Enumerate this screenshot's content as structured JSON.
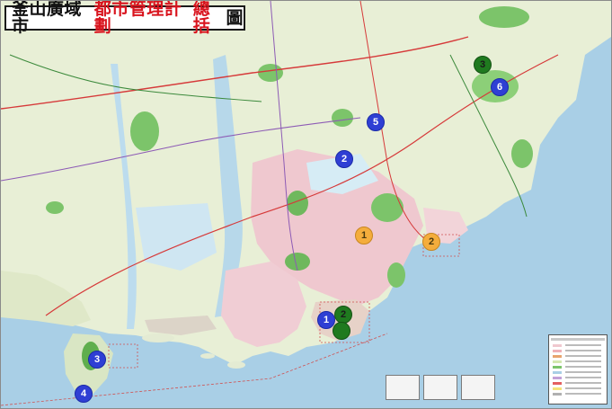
{
  "title": {
    "part1": "釜山廣域市",
    "part2": "都市管理計劃",
    "part3": "總括",
    "part4": "圖"
  },
  "markers": [
    {
      "label": "1",
      "color": "blue"
    },
    {
      "label": "2",
      "color": "blue"
    },
    {
      "label": "3",
      "color": "blue"
    },
    {
      "label": "4",
      "color": "blue"
    },
    {
      "label": "5",
      "color": "blue"
    },
    {
      "label": "6",
      "color": "blue"
    },
    {
      "label": "2",
      "color": "green"
    },
    {
      "label": "3",
      "color": "green"
    },
    {
      "label": "",
      "color": "green"
    },
    {
      "label": "1",
      "color": "orange"
    },
    {
      "label": "2",
      "color": "orange"
    }
  ],
  "colors": {
    "sea": "#a9cfe6",
    "land": "#e9eed8",
    "urban": "#efc7cf",
    "green": "#7cc46a",
    "marker_blue": "#2f3fd4",
    "marker_green": "#1f7a1f",
    "marker_orange": "#f4ad3c",
    "title_red": "#d9141e"
  }
}
